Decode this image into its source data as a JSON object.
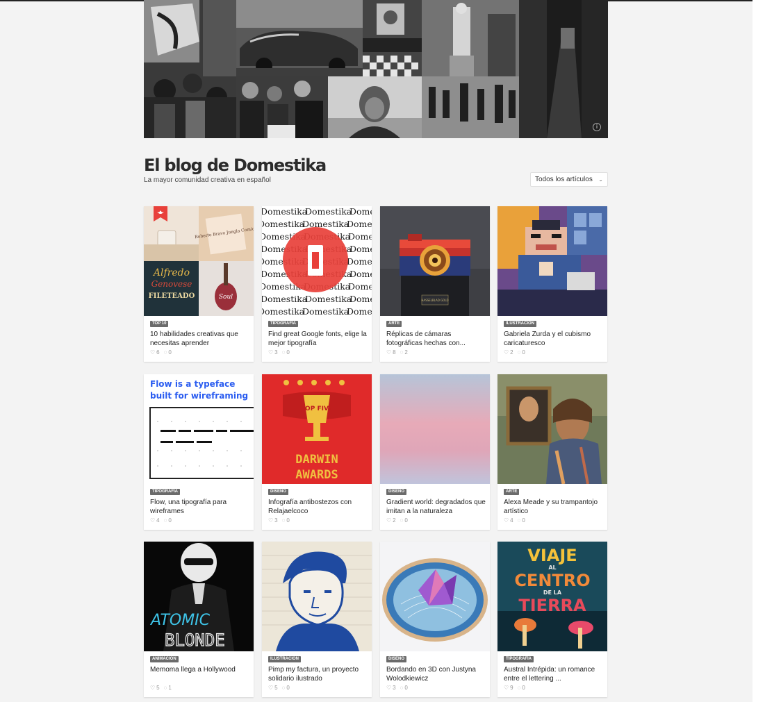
{
  "hero": {
    "info_icon": "i"
  },
  "blog": {
    "title": "El blog de Domestika",
    "subtitle": "La mayor comunidad creativa en español",
    "filter_label": "Todos los artículos"
  },
  "cards": [
    {
      "tag": "TOP 10",
      "title": "10 habilidades creativas que necesitas aprender",
      "likes": "6",
      "comments": "0"
    },
    {
      "tag": "TIPOGRAFÍA",
      "title": "Find great Google fonts, elige la mejor tipografía",
      "likes": "3",
      "comments": "0"
    },
    {
      "tag": "ARTE",
      "title": "Réplicas de cámaras fotográficas hechas con...",
      "likes": "8",
      "comments": "2"
    },
    {
      "tag": "ILUSTRACIÓN",
      "title": "Gabriela Zurda y el cubismo caricaturesco",
      "likes": "2",
      "comments": "0"
    },
    {
      "tag": "TIPOGRAFÍA",
      "title": "Flow, una tipografía para wireframes",
      "likes": "4",
      "comments": "0"
    },
    {
      "tag": "DISEÑO",
      "title": "Infografía antibostezos con Relajaelcoco",
      "likes": "3",
      "comments": "0"
    },
    {
      "tag": "DISEÑO",
      "title": "Gradient world: degradados que imitan a la naturaleza",
      "likes": "2",
      "comments": "0"
    },
    {
      "tag": "ARTE",
      "title": "Alexa Meade y su trampantojo artístico",
      "likes": "4",
      "comments": "0"
    },
    {
      "tag": "ANIMACIÓN",
      "title": "Memoma llega a Hollywood",
      "likes": "5",
      "comments": "1"
    },
    {
      "tag": "ILUSTRACIÓN",
      "title": "Pimp my factura, un proyecto solidario ilustrado",
      "likes": "5",
      "comments": "0"
    },
    {
      "tag": "DISEÑO",
      "title": "Bordando en 3D con Justyna Wolodkiewicz",
      "likes": "3",
      "comments": "0"
    },
    {
      "tag": "TIPOGRAFÍA",
      "title": "Austral Intrépida: un romance entre el lettering ...",
      "likes": "9",
      "comments": "0"
    }
  ],
  "thumb_text": {
    "c1_book": "Roberto Bravo Jungla Comics",
    "c1_alfredo": "Alfredo",
    "c1_genovese": "Genovese",
    "c1_fileteado": "FILETEADO",
    "c1_soul": "Soul",
    "c2_word": "Domestika",
    "c3_plate": "HASSELBLAD GOLD",
    "c5_line1": "Flow is a typeface",
    "c5_line2": "built for wireframing",
    "c6_top": "TOP FIVE",
    "c6_darwin": "DARWIN",
    "c6_awards": "AWARDS",
    "c9_atomic": "ATOMIC",
    "c9_blonde": "BLONDE",
    "c12_viaje": "VIAJE",
    "c12_al": "AL",
    "c12_centro": "CENTRO",
    "c12_dela": "DE LA",
    "c12_tierra": "TIERRA"
  },
  "icons": {
    "like": "♡",
    "comment": "◌",
    "chevron": "⌄"
  },
  "colors": {
    "accent_red": "#e8403a",
    "tag_bg": "#6b6b6b",
    "flow_blue": "#2a5cf0"
  }
}
